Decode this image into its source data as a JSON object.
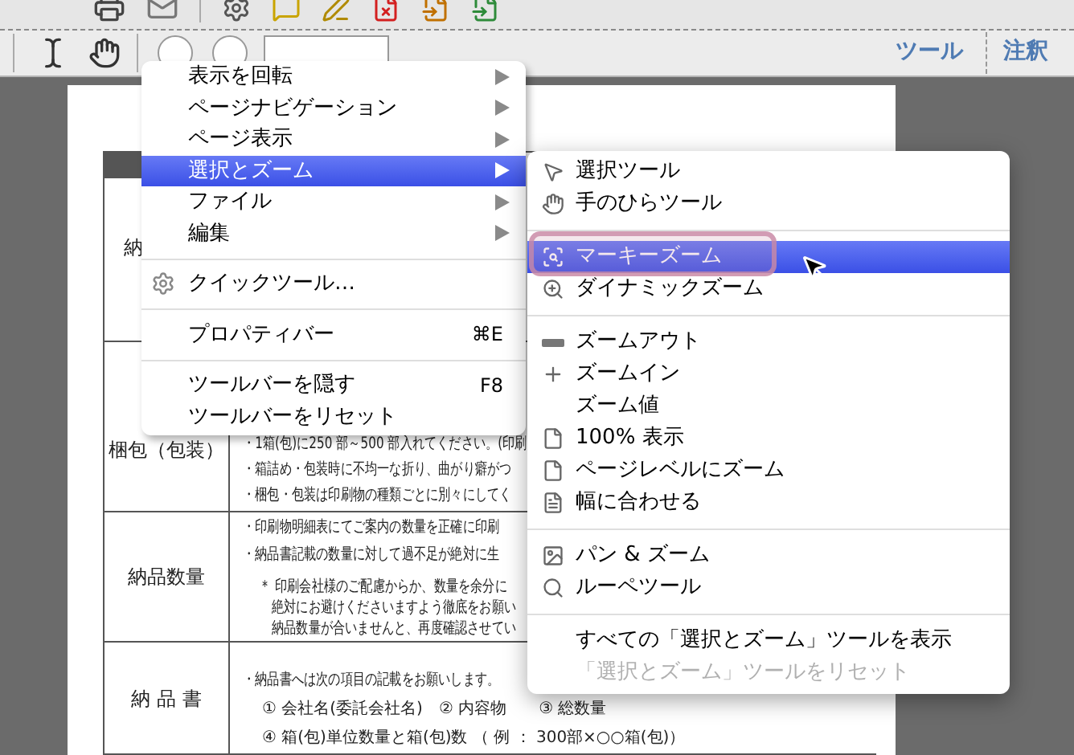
{
  "toolbar": {
    "tabs": [
      {
        "label": "ツール"
      },
      {
        "label": "注釈"
      }
    ]
  },
  "document": {
    "rows": [
      {
        "label": "納",
        "lines": []
      },
      {
        "label": "梱包（包装）",
        "lines": [
          "・1箱(包)に250 部～500 部入れてください。(印刷",
          "・箱詰め・包装時に不均一な折り、曲がり癖がつ",
          "・梱包・包装は印刷物の種類ごとに別々にしてく"
        ]
      },
      {
        "label": "納品数量",
        "lines": [
          "・印刷物明細表にてご案内の数量を正確に印刷",
          "・納品書記載の数量に対して過不足が絶対に生",
          "＊ 印刷会社様のご配慮からか、数量を余分に",
          "絶対にお避けくださいますよう徹底をお願い",
          "納品数量が合いませんと、再度確認させてい"
        ]
      },
      {
        "label": "納 品 書",
        "lines": [
          "・納品書へは次の項目の記載をお願いします。",
          "① 会社名(委託会社名)　② 内容物　　③ 総数量",
          "④ 箱(包)単位数量と箱(包)数 （ 例 ： 300部×○○箱(包)）"
        ]
      }
    ]
  },
  "context_menu": {
    "items": [
      {
        "kind": "item",
        "label": "表示を回転",
        "has_submenu": true,
        "selected": false
      },
      {
        "kind": "item",
        "label": "ページナビゲーション",
        "has_submenu": true,
        "selected": false
      },
      {
        "kind": "item",
        "label": "ページ表示",
        "has_submenu": true,
        "selected": false
      },
      {
        "kind": "item",
        "label": "選択とズーム",
        "has_submenu": true,
        "selected": true
      },
      {
        "kind": "item",
        "label": "ファイル",
        "has_submenu": true,
        "selected": false
      },
      {
        "kind": "item",
        "label": "編集",
        "has_submenu": true,
        "selected": false
      },
      {
        "kind": "separator"
      },
      {
        "kind": "item",
        "label": "クイックツール…",
        "has_submenu": false,
        "selected": false
      },
      {
        "kind": "separator"
      },
      {
        "kind": "item",
        "label": "プロパティバー",
        "shortcut": "⌘E",
        "has_submenu": false,
        "selected": false
      },
      {
        "kind": "separator"
      },
      {
        "kind": "item",
        "label": "ツールバーを隠す",
        "shortcut": "F8",
        "has_submenu": false,
        "selected": false
      },
      {
        "kind": "item",
        "label": "ツールバーをリセット",
        "has_submenu": false,
        "selected": false
      }
    ]
  },
  "submenu": {
    "items": [
      {
        "kind": "item",
        "label": "選択ツール",
        "selected": false,
        "disabled": false
      },
      {
        "kind": "item",
        "label": "手のひらツール",
        "selected": false,
        "disabled": false
      },
      {
        "kind": "separator"
      },
      {
        "kind": "item",
        "label": "マーキーズーム",
        "selected": true,
        "disabled": false
      },
      {
        "kind": "item",
        "label": "ダイナミックズーム",
        "selected": false,
        "disabled": false
      },
      {
        "kind": "separator"
      },
      {
        "kind": "item",
        "label": "ズームアウト",
        "selected": false,
        "disabled": false
      },
      {
        "kind": "item",
        "label": "ズームイン",
        "selected": false,
        "disabled": false
      },
      {
        "kind": "item",
        "label": "ズーム値",
        "selected": false,
        "disabled": false
      },
      {
        "kind": "item",
        "label": "100% 表示",
        "selected": false,
        "disabled": false
      },
      {
        "kind": "item",
        "label": "ページレベルにズーム",
        "selected": false,
        "disabled": false
      },
      {
        "kind": "item",
        "label": "幅に合わせる",
        "selected": false,
        "disabled": false
      },
      {
        "kind": "separator"
      },
      {
        "kind": "item",
        "label": "パン & ズーム",
        "selected": false,
        "disabled": false
      },
      {
        "kind": "item",
        "label": "ルーペツール",
        "selected": false,
        "disabled": false
      },
      {
        "kind": "separator"
      },
      {
        "kind": "item",
        "label": "すべての「選択とズーム」ツールを表示",
        "selected": false,
        "disabled": false
      },
      {
        "kind": "item",
        "label": "「選択とズーム」ツールをリセット",
        "selected": false,
        "disabled": true
      }
    ]
  }
}
